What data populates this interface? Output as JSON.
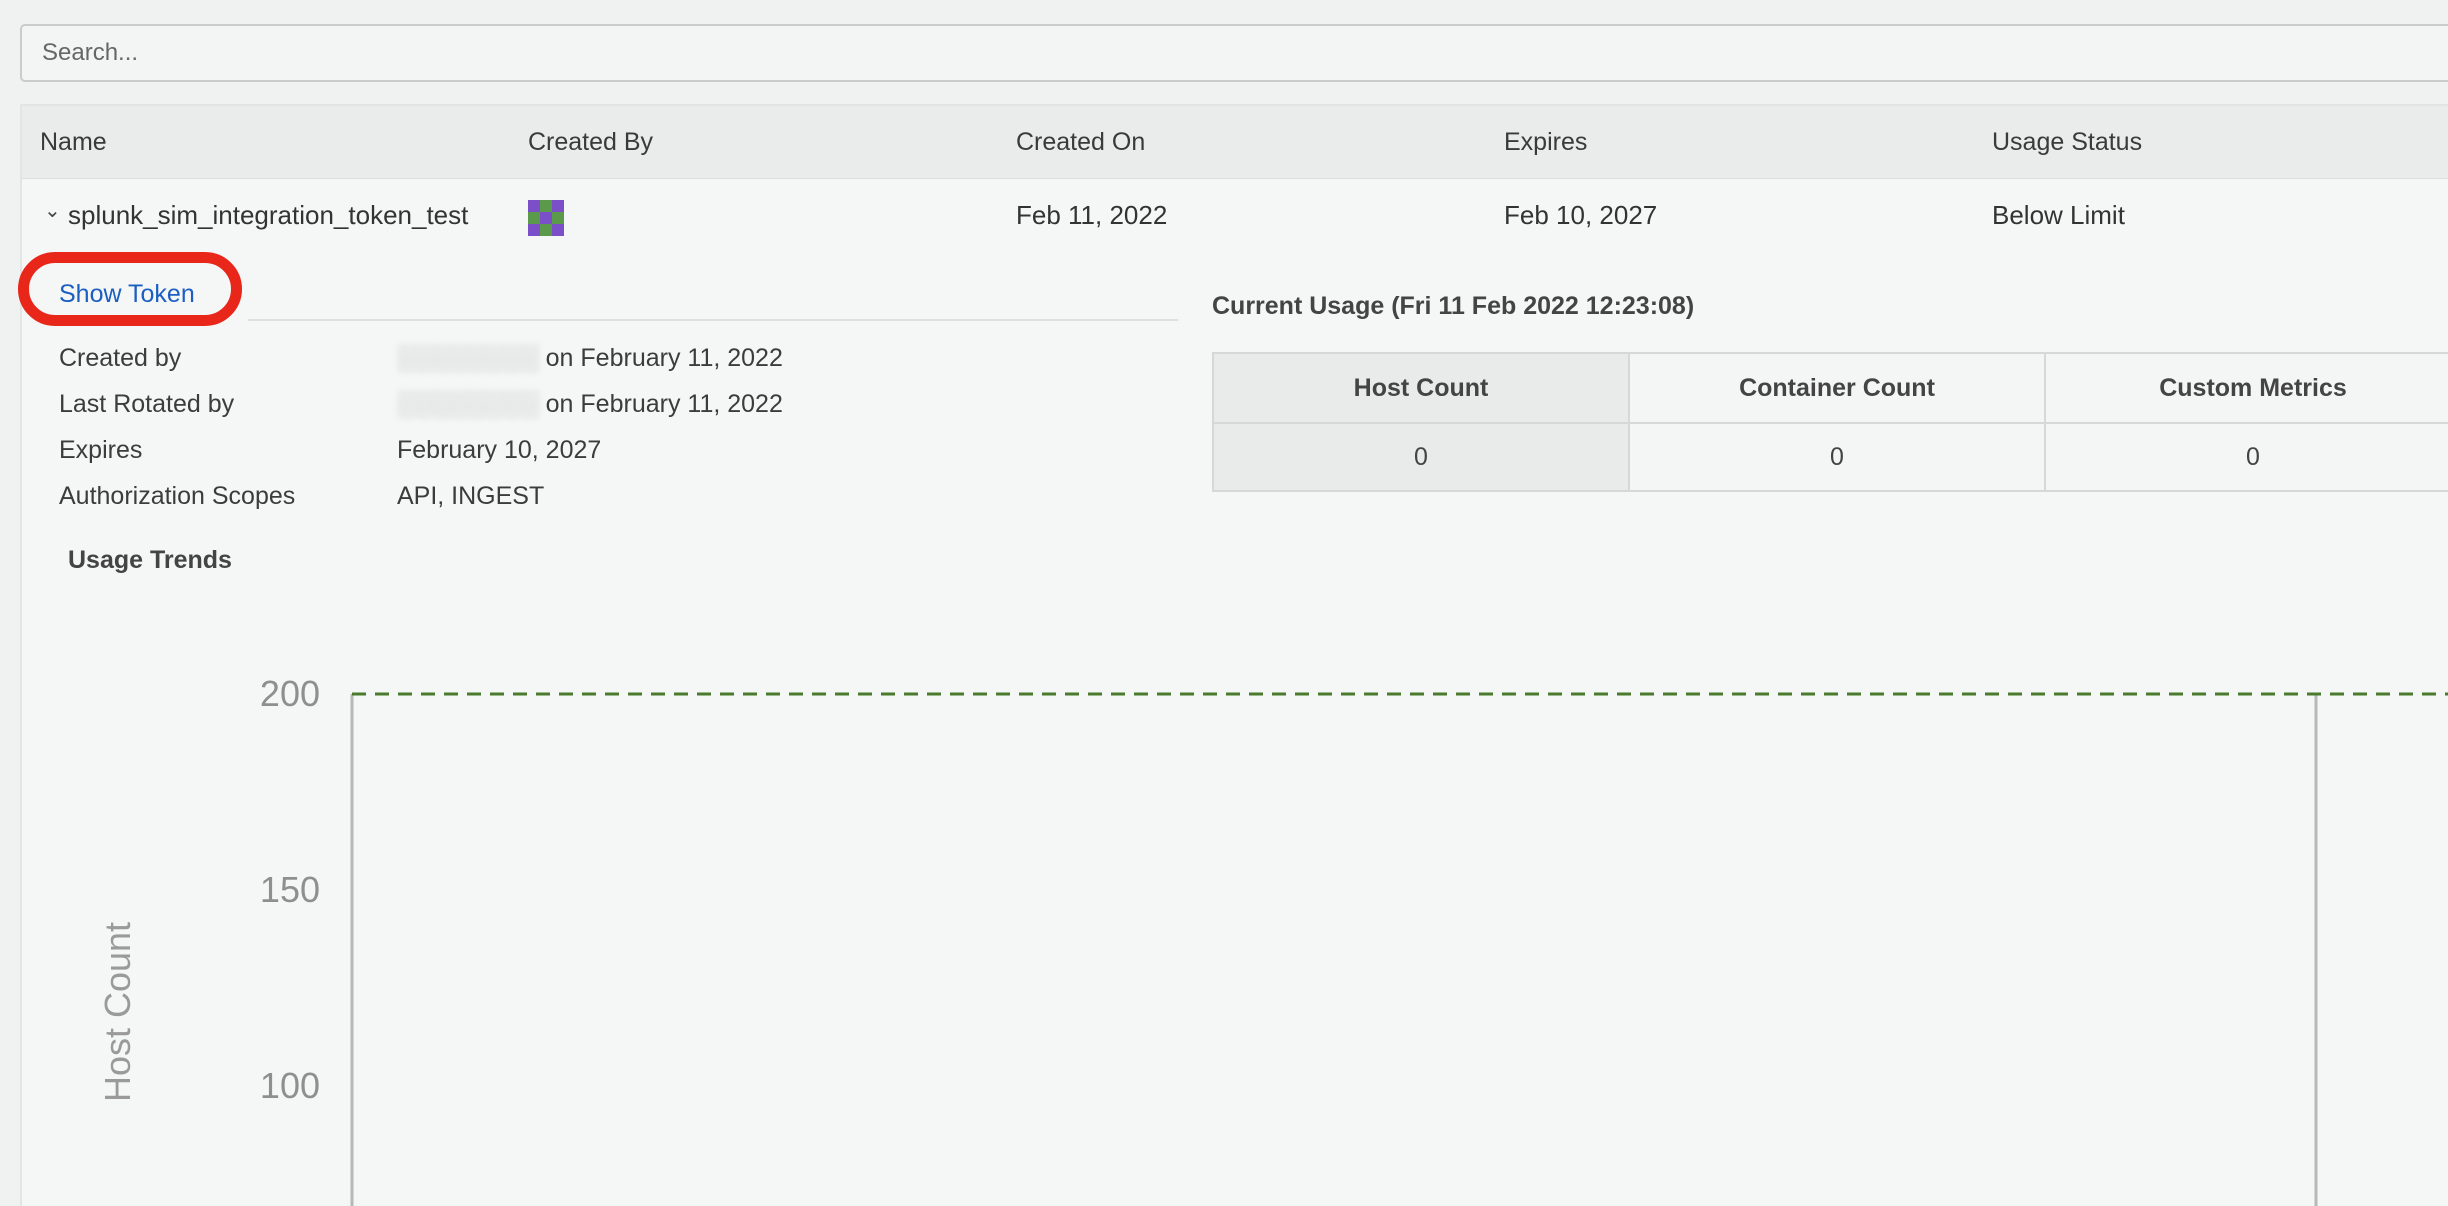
{
  "search": {
    "placeholder": "Search..."
  },
  "table": {
    "columns": [
      "Name",
      "Created By",
      "Created On",
      "Expires",
      "Usage Status"
    ],
    "row": {
      "name": "splunk_sim_integration_token_test",
      "created_by": "",
      "created_on": "Feb 11, 2022",
      "expires": "Feb 10, 2027",
      "usage_status": "Below Limit"
    }
  },
  "details": {
    "show_token_label": "Show Token",
    "items": [
      {
        "label": "Created by",
        "value": "on February 11, 2022"
      },
      {
        "label": "Last Rotated by",
        "value": "on February 11, 2022"
      },
      {
        "label": "Expires",
        "value": "February 10, 2027"
      },
      {
        "label": "Authorization Scopes",
        "value": "API, INGEST"
      }
    ],
    "usage_trends_title": "Usage Trends"
  },
  "current_usage": {
    "title": "Current Usage (Fri 11 Feb 2022 12:23:08)",
    "headers": [
      "Host Count",
      "Container Count",
      "Custom Metrics"
    ],
    "values": [
      "0",
      "0",
      "0"
    ]
  },
  "colors": {
    "link": "#1b5fc2",
    "highlight": "#e8261a",
    "limit_line": "#4a7a2c"
  },
  "chart_data": {
    "type": "line",
    "ylabel": "Host Count",
    "yticks": [
      200,
      150,
      100
    ],
    "limit": 200,
    "series": []
  }
}
